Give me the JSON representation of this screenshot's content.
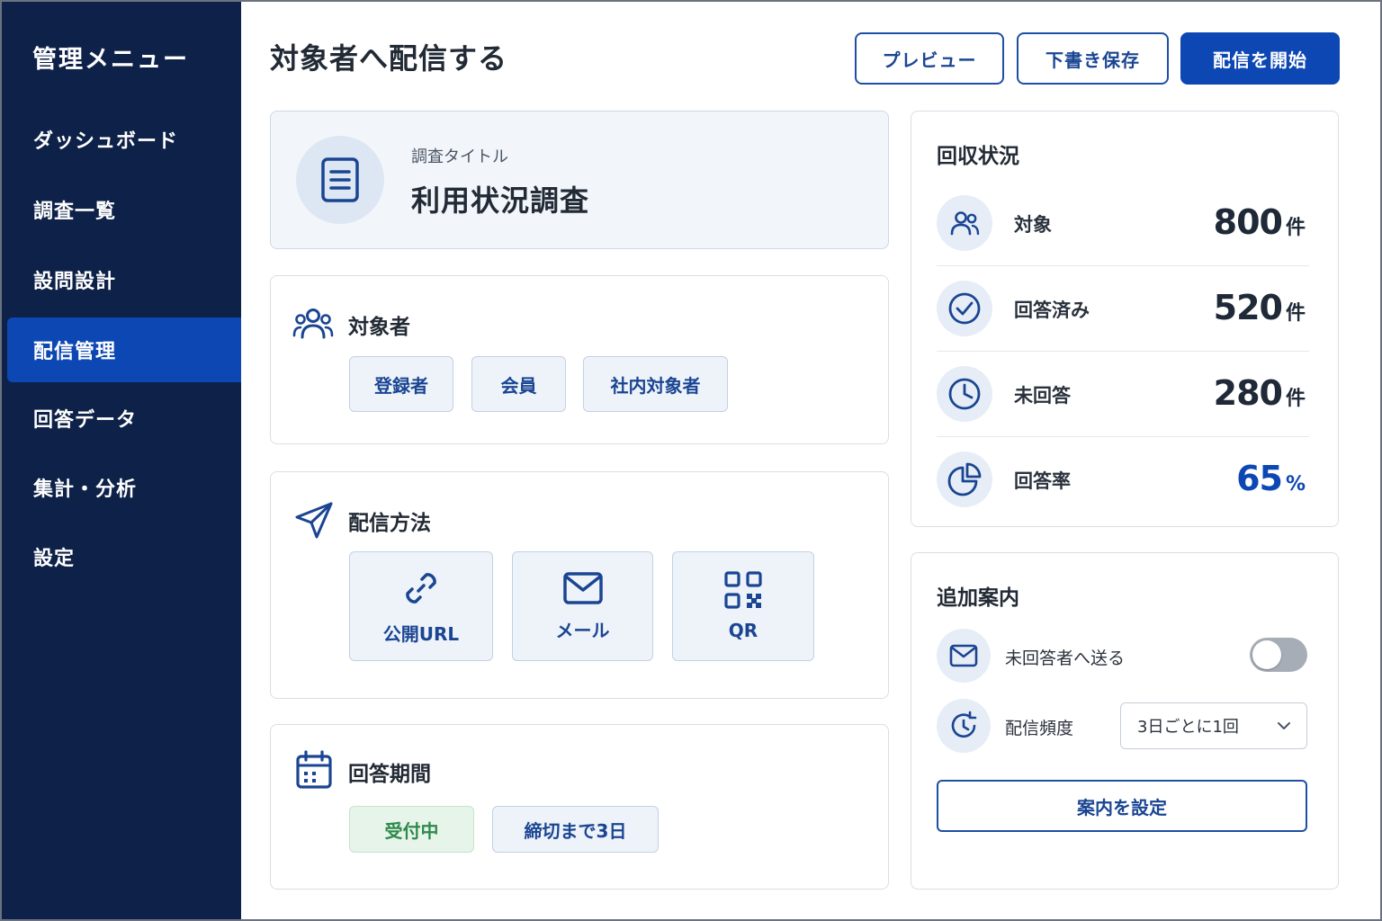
{
  "sidebar": {
    "title": "管理メニュー",
    "items": [
      {
        "label": "ダッシュボード"
      },
      {
        "label": "調査一覧"
      },
      {
        "label": "設問設計"
      },
      {
        "label": "配信管理"
      },
      {
        "label": "回答データ"
      },
      {
        "label": "集計・分析"
      },
      {
        "label": "設定"
      }
    ],
    "active_item": "配信管理"
  },
  "header": {
    "title": "対象者へ配信する",
    "preview_label": "プレビュー",
    "save_draft_label": "下書き保存",
    "start_label": "配信を開始"
  },
  "survey": {
    "label": "調査タイトル",
    "title": "利用状況調査",
    "icon": "document-icon"
  },
  "audience": {
    "title": "対象者",
    "icon": "users-icon",
    "chips": [
      "登録者",
      "会員",
      "社内対象者"
    ]
  },
  "method": {
    "title": "配信方法",
    "icon": "send-icon",
    "options": [
      {
        "label": "公開URL",
        "icon": "link-icon"
      },
      {
        "label": "メール",
        "icon": "mail-icon"
      },
      {
        "label": "QR",
        "icon": "qr-code-icon"
      }
    ]
  },
  "period": {
    "title": "回答期間",
    "icon": "calendar-icon",
    "status": "受付中",
    "deadline": "締切まで3日"
  },
  "stats": {
    "title": "回収状況",
    "rows": [
      {
        "label": "対象",
        "value": "800",
        "unit": "件",
        "icon": "users-icon"
      },
      {
        "label": "回答済み",
        "value": "520",
        "unit": "件",
        "icon": "check-circle-icon"
      },
      {
        "label": "未回答",
        "value": "280",
        "unit": "件",
        "icon": "clock-icon"
      },
      {
        "label": "回答率",
        "value": "65",
        "unit": "%",
        "icon": "pie-chart-icon"
      }
    ]
  },
  "reminder": {
    "title": "追加案内",
    "send_unanswered_label": "未回答者へ送る",
    "send_unanswered_enabled": false,
    "frequency_label": "配信頻度",
    "frequency_value": "3日ごとに1回",
    "setup_label": "案内を設定"
  },
  "colors": {
    "sidebar_bg": "#0e2148",
    "accent": "#0d47b3",
    "status_green": "#2e8a4c"
  }
}
